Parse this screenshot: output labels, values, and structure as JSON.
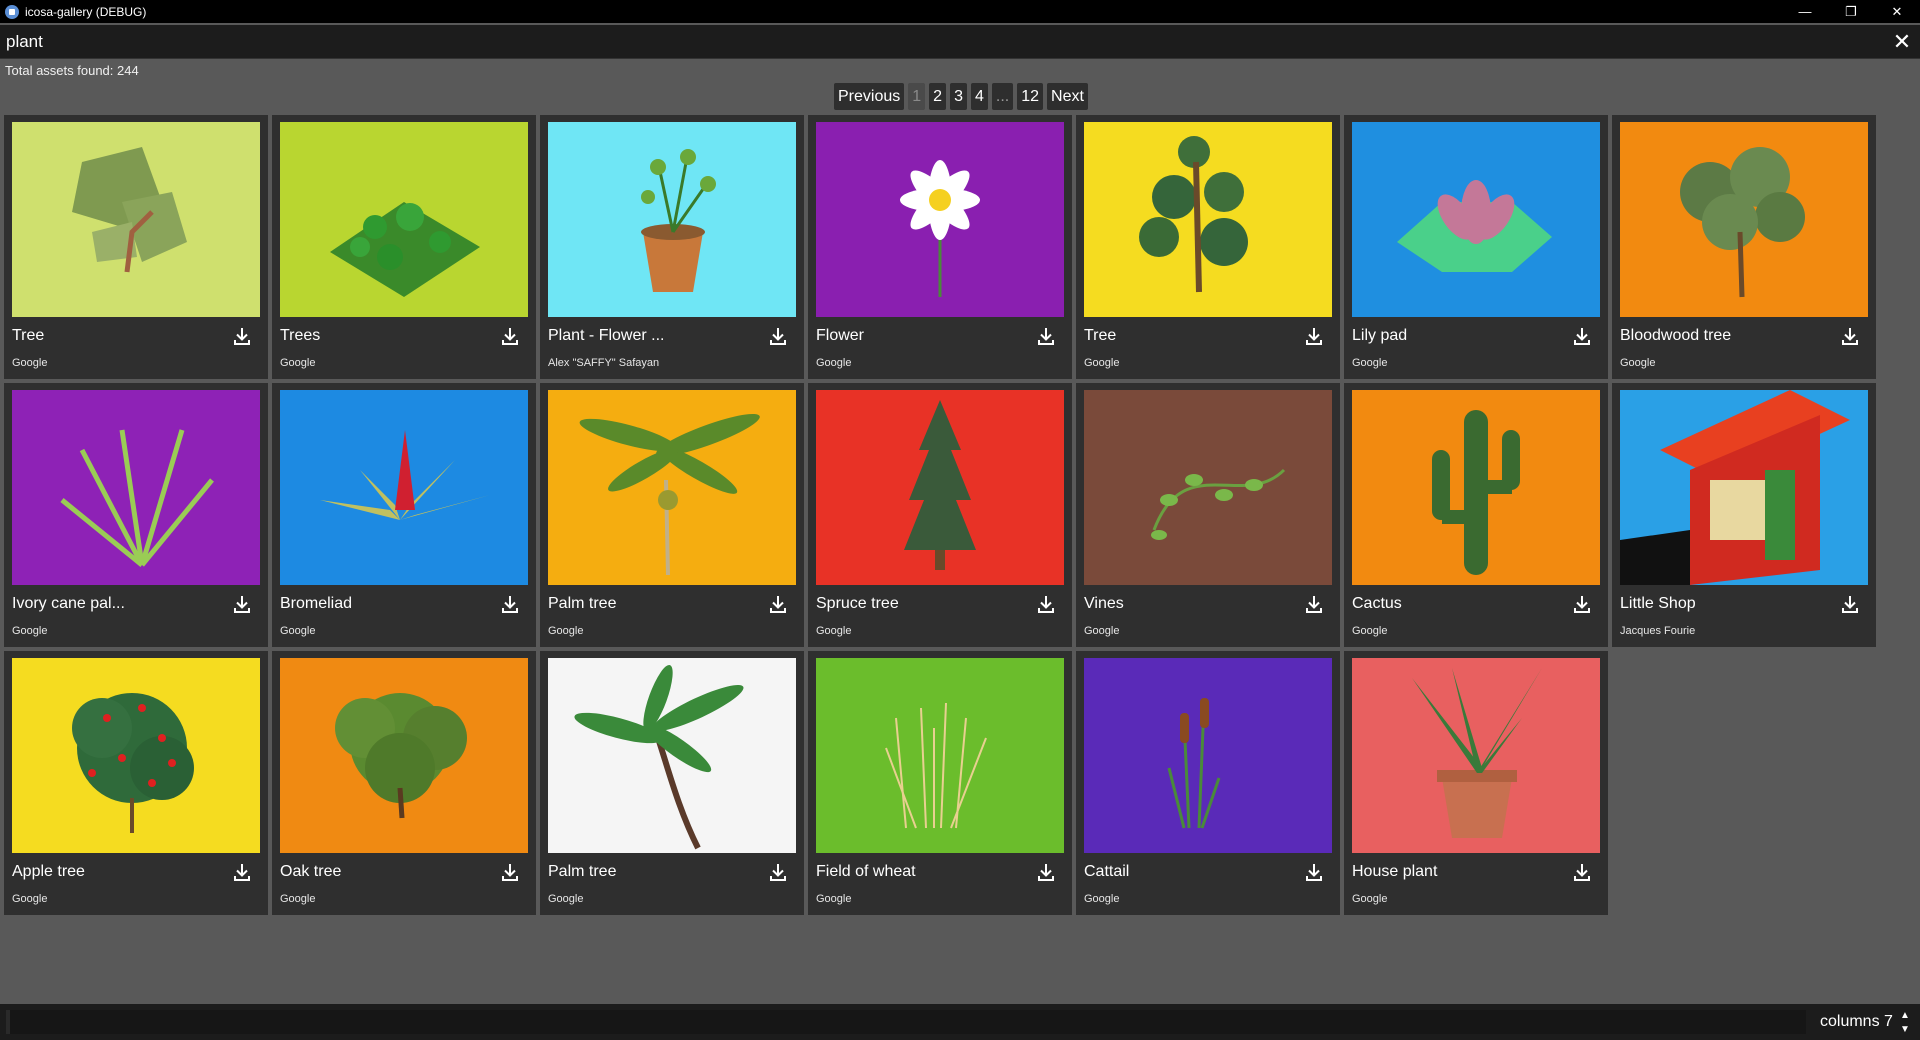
{
  "window": {
    "title": "icosa-gallery (DEBUG)",
    "minimize": "—",
    "restore": "❐",
    "close": "✕"
  },
  "search": {
    "value": "plant",
    "clear_icon": "✕"
  },
  "total_text": "Total assets found: 244",
  "pagination": {
    "previous": "Previous",
    "pages": [
      "1",
      "2",
      "3",
      "4",
      "...",
      "12"
    ],
    "current": "1",
    "next": "Next"
  },
  "cards": [
    {
      "title": "Tree",
      "author": "Google",
      "bg": "#cfe06e"
    },
    {
      "title": "Trees",
      "author": "Google",
      "bg": "#b9d630"
    },
    {
      "title": "Plant - Flower ...",
      "author": "Alex \"SAFFY\" Safayan",
      "bg": "#6fe6f5"
    },
    {
      "title": "Flower",
      "author": "Google",
      "bg": "#8a1fb0"
    },
    {
      "title": "Tree",
      "author": "Google",
      "bg": "#f5dc20"
    },
    {
      "title": "Lily pad",
      "author": "Google",
      "bg": "#1f8fe0"
    },
    {
      "title": "Bloodwood tree",
      "author": "Google",
      "bg": "#f28a10"
    },
    {
      "title": "Ivory cane pal...",
      "author": "Google",
      "bg": "#8e22b6"
    },
    {
      "title": "Bromeliad",
      "author": "Google",
      "bg": "#1d8ae2"
    },
    {
      "title": "Palm tree",
      "author": "Google",
      "bg": "#f5ad10"
    },
    {
      "title": "Spruce tree",
      "author": "Google",
      "bg": "#e83226"
    },
    {
      "title": "Vines",
      "author": "Google",
      "bg": "#7a4a3a"
    },
    {
      "title": "Cactus",
      "author": "Google",
      "bg": "#f28a10"
    },
    {
      "title": "Little Shop",
      "author": "Jacques Fourie",
      "bg": "#2aa0e6"
    },
    {
      "title": "Apple tree",
      "author": "Google",
      "bg": "#f5dc20"
    },
    {
      "title": "Oak tree",
      "author": "Google",
      "bg": "#f08a12"
    },
    {
      "title": "Palm tree",
      "author": "Google",
      "bg": "#f5f5f5"
    },
    {
      "title": "Field of wheat",
      "author": "Google",
      "bg": "#6bbd2c"
    },
    {
      "title": "Cattail",
      "author": "Google",
      "bg": "#5a2ab8"
    },
    {
      "title": "House plant",
      "author": "Google",
      "bg": "#e86060"
    }
  ],
  "download_icon": "download-icon",
  "footer": {
    "columns_label": "columns 7",
    "up": "▲",
    "down": "▼"
  }
}
